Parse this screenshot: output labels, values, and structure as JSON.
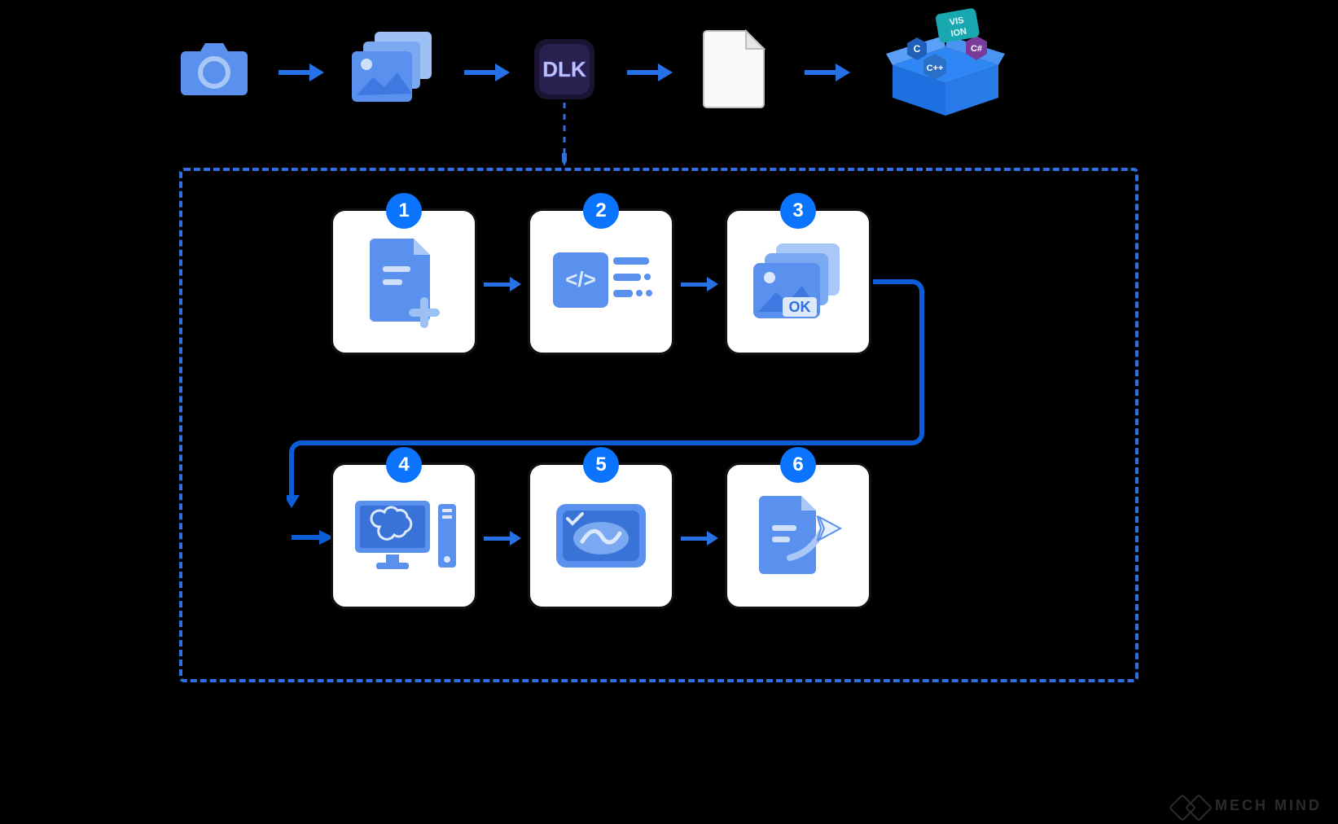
{
  "top_row": {
    "items": [
      {
        "name": "camera-icon"
      },
      {
        "name": "images-stack-icon"
      },
      {
        "name": "dlk-app-icon",
        "label": "DLK"
      },
      {
        "name": "blank-document-icon"
      },
      {
        "name": "sdk-box-icon",
        "badges": [
          "C",
          "C++",
          "C#"
        ],
        "box_label": "VISION"
      }
    ]
  },
  "steps": [
    {
      "num": "1",
      "name": "create-document-icon"
    },
    {
      "num": "2",
      "name": "code-list-icon"
    },
    {
      "num": "3",
      "name": "images-ok-icon",
      "ok_label": "OK"
    },
    {
      "num": "4",
      "name": "ai-workstation-icon"
    },
    {
      "num": "5",
      "name": "validate-scribble-icon"
    },
    {
      "num": "6",
      "name": "export-document-icon"
    }
  ],
  "watermark": {
    "text": "MECH MIND"
  },
  "colors": {
    "arrow": "#2771e6",
    "accent": "#0b74ff",
    "icon_fill": "#5a91ee",
    "icon_light": "#aac8f7"
  }
}
